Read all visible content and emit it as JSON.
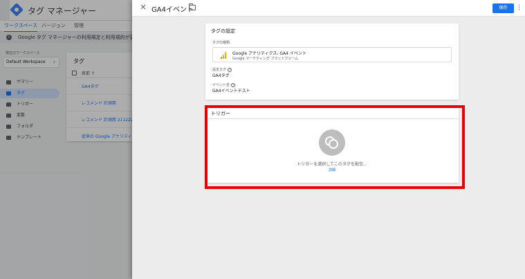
{
  "background_app": {
    "app_title": "タグ マネージャー",
    "tabs": [
      "ワークスペース",
      "バージョン",
      "管理"
    ],
    "notice": "Google タグ マネージャーの利用規定と利用規約が更新されまし",
    "workspace_label": "現在のワークスペース",
    "workspace_value": "Default Workspace",
    "nav": [
      "サマリー",
      "タグ",
      "トリガー",
      "変数",
      "フォルダ",
      "テンプレート"
    ],
    "tag_panel": {
      "title": "タグ",
      "column_name": "名前 ↑",
      "rows": [
        "GA4タグ",
        "レコメンド 計測用",
        "レコメンド 計測用 211222",
        "従来の Google アナリティク"
      ]
    }
  },
  "drawer": {
    "close_icon": "close-icon",
    "title": "GA4イベント",
    "folder_icon": "folder-icon",
    "save_label": "保存",
    "more_icon": "⋮",
    "config_card": {
      "title": "タグの設定",
      "type_label": "タグの種類",
      "type_name": "Google アナリティクス: GA4 イベント",
      "type_sub": "Google マーケティング プラットフォーム",
      "config_tag_label": "設定タグ",
      "config_tag_value": "GA4タグ",
      "event_name_label": "イベント名",
      "event_name_value": "GA4イベントテスト",
      "help_glyph": "?"
    },
    "trigger_card": {
      "title": "トリガー",
      "hint": "トリガーを選択してこのタグを配信...",
      "more_link": "詳細"
    }
  },
  "colors": {
    "accent": "#1a73e8",
    "highlight": "#e60000",
    "ga_orange": "#f9ab00",
    "ga_dark_orange": "#e37400"
  }
}
